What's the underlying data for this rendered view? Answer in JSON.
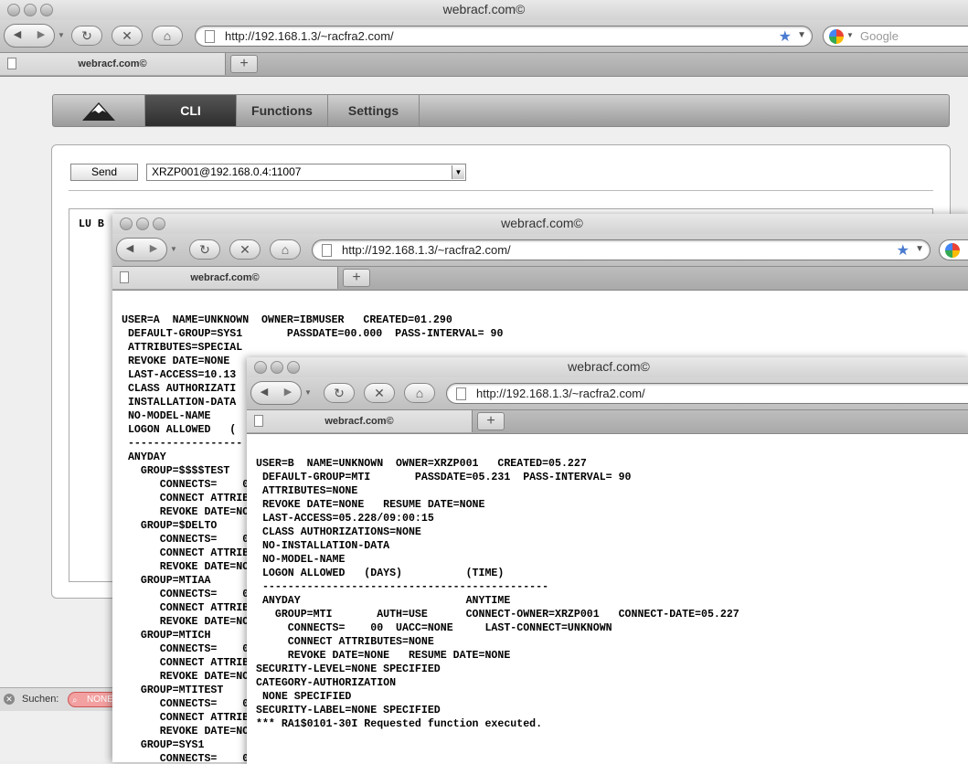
{
  "window_title": "webracf.com©",
  "url": "http://192.168.1.3/~racfra2.com/",
  "tab_title": "webracf.com©",
  "search_placeholder": "Google",
  "app": {
    "nav": [
      "CLI",
      "Functions",
      "Settings"
    ],
    "send_label": "Send",
    "target_value": "XRZP001@192.168.0.4:11007",
    "command_text": "LU B"
  },
  "findbar": {
    "label": "Suchen:",
    "value": "NONE"
  },
  "output_a": "USER=A  NAME=UNKNOWN  OWNER=IBMUSER   CREATED=01.290\n DEFAULT-GROUP=SYS1       PASSDATE=00.000  PASS-INTERVAL= 90\n ATTRIBUTES=SPECIAL\n REVOKE DATE=NONE\n LAST-ACCESS=10.13\n CLASS AUTHORIZATI\n INSTALLATION-DATA\n NO-MODEL-NAME\n LOGON ALLOWED   (\n ------------------\n ANYDAY\n   GROUP=$$$$TEST\n      CONNECTS=    0\n      CONNECT ATTRIB\n      REVOKE DATE=NO\n   GROUP=$DELTO\n      CONNECTS=    0\n      CONNECT ATTRIB\n      REVOKE DATE=NO\n   GROUP=MTIAA\n      CONNECTS=    0\n      CONNECT ATTRIB\n      REVOKE DATE=NO\n   GROUP=MTICH\n      CONNECTS=    0\n      CONNECT ATTRIB\n      REVOKE DATE=NO\n   GROUP=MTITEST\n      CONNECTS=    0\n      CONNECT ATTRIB\n      REVOKE DATE=NO\n   GROUP=SYS1\n      CONNECTS=    0",
  "output_b": "USER=B  NAME=UNKNOWN  OWNER=XRZP001   CREATED=05.227\n DEFAULT-GROUP=MTI       PASSDATE=05.231  PASS-INTERVAL= 90\n ATTRIBUTES=NONE\n REVOKE DATE=NONE   RESUME DATE=NONE\n LAST-ACCESS=05.228/09:00:15\n CLASS AUTHORIZATIONS=NONE\n NO-INSTALLATION-DATA\n NO-MODEL-NAME\n LOGON ALLOWED   (DAYS)          (TIME)\n ---------------------------------------------\n ANYDAY                          ANYTIME\n   GROUP=MTI       AUTH=USE      CONNECT-OWNER=XRZP001   CONNECT-DATE=05.227\n     CONNECTS=    00  UACC=NONE     LAST-CONNECT=UNKNOWN\n     CONNECT ATTRIBUTES=NONE\n     REVOKE DATE=NONE   RESUME DATE=NONE\nSECURITY-LEVEL=NONE SPECIFIED\nCATEGORY-AUTHORIZATION\n NONE SPECIFIED\nSECURITY-LABEL=NONE SPECIFIED\n*** RA1$0101-30I Requested function executed."
}
